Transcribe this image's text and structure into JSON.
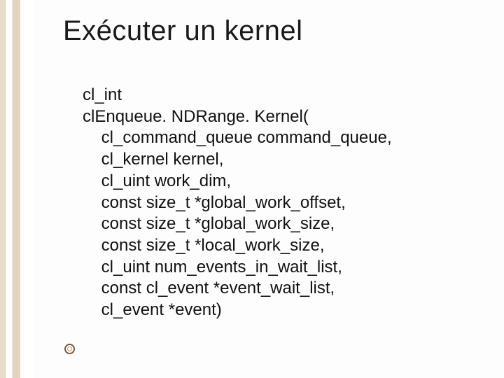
{
  "slide": {
    "title": "Exécuter un kernel",
    "code": {
      "l0": "cl_int",
      "l1": "clEnqueue. NDRange. Kernel(",
      "l2": "    cl_command_queue command_queue,",
      "l3": "    cl_kernel kernel,",
      "l4": "    cl_uint work_dim,",
      "l5": "    const size_t *global_work_offset,",
      "l6": "    const size_t *global_work_size,",
      "l7": "    const size_t *local_work_size,",
      "l8": "    cl_uint num_events_in_wait_list,",
      "l9": "    const cl_event *event_wait_list,",
      "l10": "    cl_event *event)"
    }
  }
}
